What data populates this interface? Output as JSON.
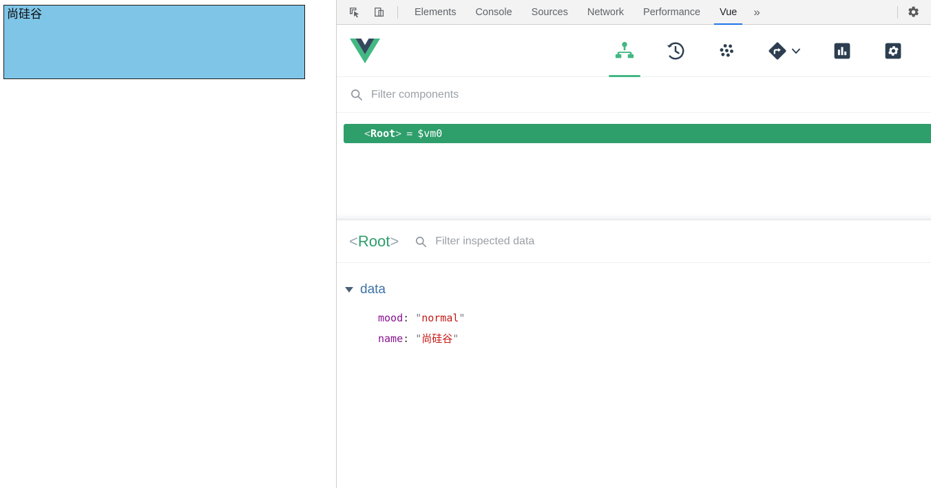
{
  "page": {
    "box_text": "尚硅谷",
    "box_color": "#7ec5e8"
  },
  "devtools": {
    "toolbar": {
      "inspect_icon": "inspect-element-icon",
      "device_icon": "device-toolbar-icon",
      "tabs": [
        {
          "label": "Elements",
          "active": false
        },
        {
          "label": "Console",
          "active": false
        },
        {
          "label": "Sources",
          "active": false
        },
        {
          "label": "Network",
          "active": false
        },
        {
          "label": "Performance",
          "active": false
        },
        {
          "label": "Vue",
          "active": true
        }
      ],
      "more_label": "»",
      "settings_icon": "gear-icon",
      "active_tab_underline_color": "#1a73e8"
    }
  },
  "vue_devtools": {
    "logo": "vue-logo",
    "accent_color": "#42b883",
    "tabs": [
      {
        "name": "components",
        "icon": "component-tree-icon",
        "active": true
      },
      {
        "name": "timeline",
        "icon": "history-clock-icon",
        "active": false
      },
      {
        "name": "vuex",
        "icon": "vuex-dots-icon",
        "active": false
      },
      {
        "name": "routing",
        "icon": "router-diamond-icon",
        "active": false,
        "has_caret": true
      },
      {
        "name": "performance",
        "icon": "bar-chart-icon",
        "active": false
      },
      {
        "name": "settings",
        "icon": "gear-icon",
        "active": false
      }
    ],
    "components_filter": {
      "placeholder": "Filter components",
      "value": "",
      "icon": "search-icon"
    },
    "tree": [
      {
        "open_angle": "<",
        "name": "Root",
        "close_angle": ">",
        "equals": "=",
        "instance": "$vm0",
        "selected": true,
        "selected_color": "#2e9e6b"
      }
    ],
    "inspector": {
      "open_angle": "<",
      "component_name": "Root",
      "close_angle": ">",
      "filter": {
        "placeholder": "Filter inspected data",
        "value": "",
        "icon": "search-icon"
      },
      "groups": [
        {
          "title": "data",
          "expanded": true,
          "entries": [
            {
              "key": "mood",
              "colon": ":",
              "quote": "\"",
              "value": "normal"
            },
            {
              "key": "name",
              "colon": ":",
              "quote": "\"",
              "value": "尚硅谷"
            }
          ]
        }
      ]
    }
  }
}
